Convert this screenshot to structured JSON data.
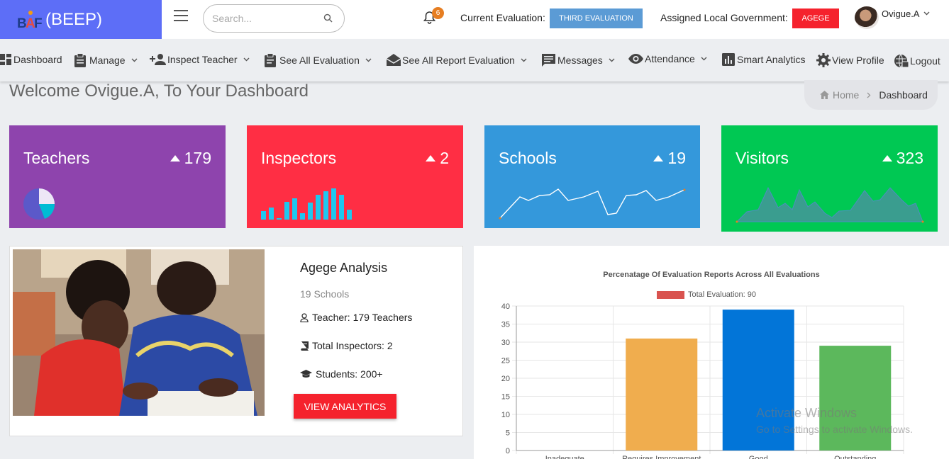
{
  "header": {
    "brand": "(BEEP)",
    "search_placeholder": "Search...",
    "notification_count": "6",
    "current_eval_label": "Current Evaluation:",
    "current_eval_value": "THIRD EVALUATION",
    "lga_label": "Assigned Local Government:",
    "lga_value": "AGEGE",
    "user_name": "Ovigue.A"
  },
  "nav": [
    {
      "label": "Dashboard",
      "icon": "grid-icon",
      "dropdown": false
    },
    {
      "label": "Manage",
      "icon": "clipboard-icon",
      "dropdown": true
    },
    {
      "label": "Inspect Teacher",
      "icon": "person-add-icon",
      "dropdown": true
    },
    {
      "label": "See All Evaluation",
      "icon": "clipboard-list-icon",
      "dropdown": true
    },
    {
      "label": "See All Report Evaluation",
      "icon": "envelope-open-icon",
      "dropdown": true
    },
    {
      "label": "Messages",
      "icon": "message-icon",
      "dropdown": true
    },
    {
      "label": "Attendance",
      "icon": "eye-icon",
      "dropdown": true
    },
    {
      "label": "Smart Analytics",
      "icon": "bar-chart-icon",
      "dropdown": false
    },
    {
      "label": "View Profile",
      "icon": "gear-icon",
      "dropdown": false
    },
    {
      "label": "Logout",
      "icon": "globe-lock-icon",
      "dropdown": false
    }
  ],
  "welcome": "Welcome Ovigue.A, To Your Dashboard",
  "breadcrumb": {
    "home": "Home",
    "current": "Dashboard"
  },
  "cards": [
    {
      "title": "Teachers",
      "value": "179",
      "color": "#8e44ad"
    },
    {
      "title": "Inspectors",
      "value": "2",
      "color": "#ff2e44"
    },
    {
      "title": "Schools",
      "value": "19",
      "color": "#3498db"
    },
    {
      "title": "Visitors",
      "value": "323",
      "color": "#00c853"
    }
  ],
  "analysis": {
    "title": "Agege Analysis",
    "schools": "19 Schools",
    "teachers": "Teacher: 179 Teachers",
    "inspectors": "Total Inspectors: 2",
    "students": "Students: 200+",
    "button": "VIEW ANALYTICS"
  },
  "chart_data": {
    "type": "bar",
    "title": "Percenatage Of Evaluation Reports Across All Evaluations",
    "legend": "Total Evaluation: 90",
    "categories": [
      "Inadequate",
      "Requires Improvement",
      "Good",
      "Outstanding"
    ],
    "values": [
      0,
      31,
      39,
      29
    ],
    "colors": [
      "#d9534f",
      "#f0ad4e",
      "#0275d8",
      "#5cb85c"
    ],
    "ylim": [
      0,
      40
    ],
    "yticks": [
      0,
      5,
      10,
      15,
      20,
      25,
      30,
      35,
      40
    ],
    "grid": true
  },
  "watermark": {
    "line1": "Activate Windows",
    "line2": "Go to Settings to activate Windows."
  }
}
